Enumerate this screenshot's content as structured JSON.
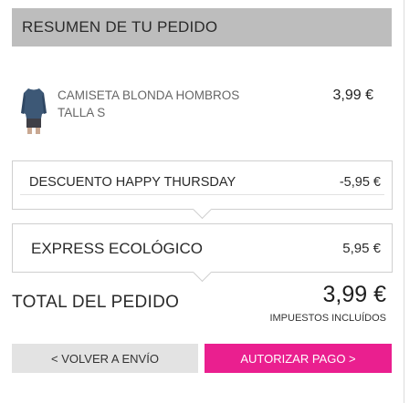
{
  "header": {
    "title": "RESUMEN DE TU PEDIDO"
  },
  "product": {
    "name_line1": "CAMISETA BLONDA HOMBROS",
    "name_line2": "TALLA S",
    "price": "3,99 €"
  },
  "discount": {
    "label": "DESCUENTO HAPPY THURSDAY",
    "value": "-5,95 €"
  },
  "shipping": {
    "label": "EXPRESS ECOLÓGICO",
    "value": "5,95 €"
  },
  "total": {
    "label": "TOTAL DEL PEDIDO",
    "value": "3,99 €",
    "tax_note": "IMPUESTOS INCLUÍDOS"
  },
  "buttons": {
    "back_label": "< VOLVER A ENVÍO",
    "pay_label": "AUTORIZAR PAGO >"
  },
  "colors": {
    "header_bg": "#bdbdbd",
    "pay_button": "#ea1f8f",
    "back_button": "#e3e3e3"
  }
}
